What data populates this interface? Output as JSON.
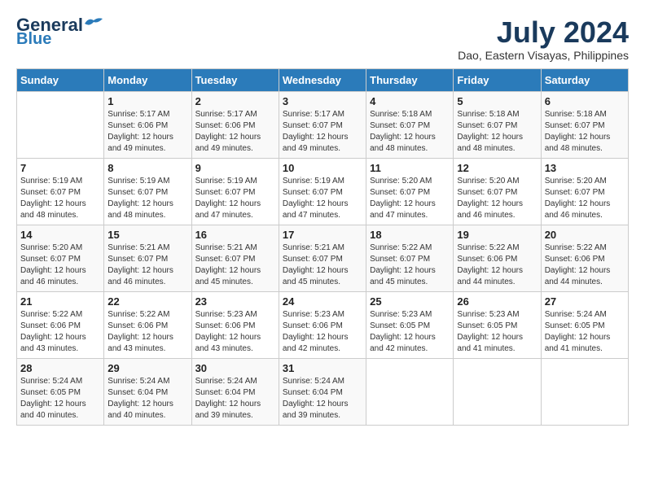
{
  "logo": {
    "line1": "General",
    "line2": "Blue"
  },
  "title": {
    "month_year": "July 2024",
    "location": "Dao, Eastern Visayas, Philippines"
  },
  "header": {
    "days": [
      "Sunday",
      "Monday",
      "Tuesday",
      "Wednesday",
      "Thursday",
      "Friday",
      "Saturday"
    ]
  },
  "weeks": [
    [
      {
        "day": "",
        "info": ""
      },
      {
        "day": "1",
        "info": "Sunrise: 5:17 AM\nSunset: 6:06 PM\nDaylight: 12 hours\nand 49 minutes."
      },
      {
        "day": "2",
        "info": "Sunrise: 5:17 AM\nSunset: 6:06 PM\nDaylight: 12 hours\nand 49 minutes."
      },
      {
        "day": "3",
        "info": "Sunrise: 5:17 AM\nSunset: 6:07 PM\nDaylight: 12 hours\nand 49 minutes."
      },
      {
        "day": "4",
        "info": "Sunrise: 5:18 AM\nSunset: 6:07 PM\nDaylight: 12 hours\nand 48 minutes."
      },
      {
        "day": "5",
        "info": "Sunrise: 5:18 AM\nSunset: 6:07 PM\nDaylight: 12 hours\nand 48 minutes."
      },
      {
        "day": "6",
        "info": "Sunrise: 5:18 AM\nSunset: 6:07 PM\nDaylight: 12 hours\nand 48 minutes."
      }
    ],
    [
      {
        "day": "7",
        "info": "Sunrise: 5:19 AM\nSunset: 6:07 PM\nDaylight: 12 hours\nand 48 minutes."
      },
      {
        "day": "8",
        "info": "Sunrise: 5:19 AM\nSunset: 6:07 PM\nDaylight: 12 hours\nand 48 minutes."
      },
      {
        "day": "9",
        "info": "Sunrise: 5:19 AM\nSunset: 6:07 PM\nDaylight: 12 hours\nand 47 minutes."
      },
      {
        "day": "10",
        "info": "Sunrise: 5:19 AM\nSunset: 6:07 PM\nDaylight: 12 hours\nand 47 minutes."
      },
      {
        "day": "11",
        "info": "Sunrise: 5:20 AM\nSunset: 6:07 PM\nDaylight: 12 hours\nand 47 minutes."
      },
      {
        "day": "12",
        "info": "Sunrise: 5:20 AM\nSunset: 6:07 PM\nDaylight: 12 hours\nand 46 minutes."
      },
      {
        "day": "13",
        "info": "Sunrise: 5:20 AM\nSunset: 6:07 PM\nDaylight: 12 hours\nand 46 minutes."
      }
    ],
    [
      {
        "day": "14",
        "info": "Sunrise: 5:20 AM\nSunset: 6:07 PM\nDaylight: 12 hours\nand 46 minutes."
      },
      {
        "day": "15",
        "info": "Sunrise: 5:21 AM\nSunset: 6:07 PM\nDaylight: 12 hours\nand 46 minutes."
      },
      {
        "day": "16",
        "info": "Sunrise: 5:21 AM\nSunset: 6:07 PM\nDaylight: 12 hours\nand 45 minutes."
      },
      {
        "day": "17",
        "info": "Sunrise: 5:21 AM\nSunset: 6:07 PM\nDaylight: 12 hours\nand 45 minutes."
      },
      {
        "day": "18",
        "info": "Sunrise: 5:22 AM\nSunset: 6:07 PM\nDaylight: 12 hours\nand 45 minutes."
      },
      {
        "day": "19",
        "info": "Sunrise: 5:22 AM\nSunset: 6:06 PM\nDaylight: 12 hours\nand 44 minutes."
      },
      {
        "day": "20",
        "info": "Sunrise: 5:22 AM\nSunset: 6:06 PM\nDaylight: 12 hours\nand 44 minutes."
      }
    ],
    [
      {
        "day": "21",
        "info": "Sunrise: 5:22 AM\nSunset: 6:06 PM\nDaylight: 12 hours\nand 43 minutes."
      },
      {
        "day": "22",
        "info": "Sunrise: 5:22 AM\nSunset: 6:06 PM\nDaylight: 12 hours\nand 43 minutes."
      },
      {
        "day": "23",
        "info": "Sunrise: 5:23 AM\nSunset: 6:06 PM\nDaylight: 12 hours\nand 43 minutes."
      },
      {
        "day": "24",
        "info": "Sunrise: 5:23 AM\nSunset: 6:06 PM\nDaylight: 12 hours\nand 42 minutes."
      },
      {
        "day": "25",
        "info": "Sunrise: 5:23 AM\nSunset: 6:05 PM\nDaylight: 12 hours\nand 42 minutes."
      },
      {
        "day": "26",
        "info": "Sunrise: 5:23 AM\nSunset: 6:05 PM\nDaylight: 12 hours\nand 41 minutes."
      },
      {
        "day": "27",
        "info": "Sunrise: 5:24 AM\nSunset: 6:05 PM\nDaylight: 12 hours\nand 41 minutes."
      }
    ],
    [
      {
        "day": "28",
        "info": "Sunrise: 5:24 AM\nSunset: 6:05 PM\nDaylight: 12 hours\nand 40 minutes."
      },
      {
        "day": "29",
        "info": "Sunrise: 5:24 AM\nSunset: 6:04 PM\nDaylight: 12 hours\nand 40 minutes."
      },
      {
        "day": "30",
        "info": "Sunrise: 5:24 AM\nSunset: 6:04 PM\nDaylight: 12 hours\nand 39 minutes."
      },
      {
        "day": "31",
        "info": "Sunrise: 5:24 AM\nSunset: 6:04 PM\nDaylight: 12 hours\nand 39 minutes."
      },
      {
        "day": "",
        "info": ""
      },
      {
        "day": "",
        "info": ""
      },
      {
        "day": "",
        "info": ""
      }
    ]
  ]
}
